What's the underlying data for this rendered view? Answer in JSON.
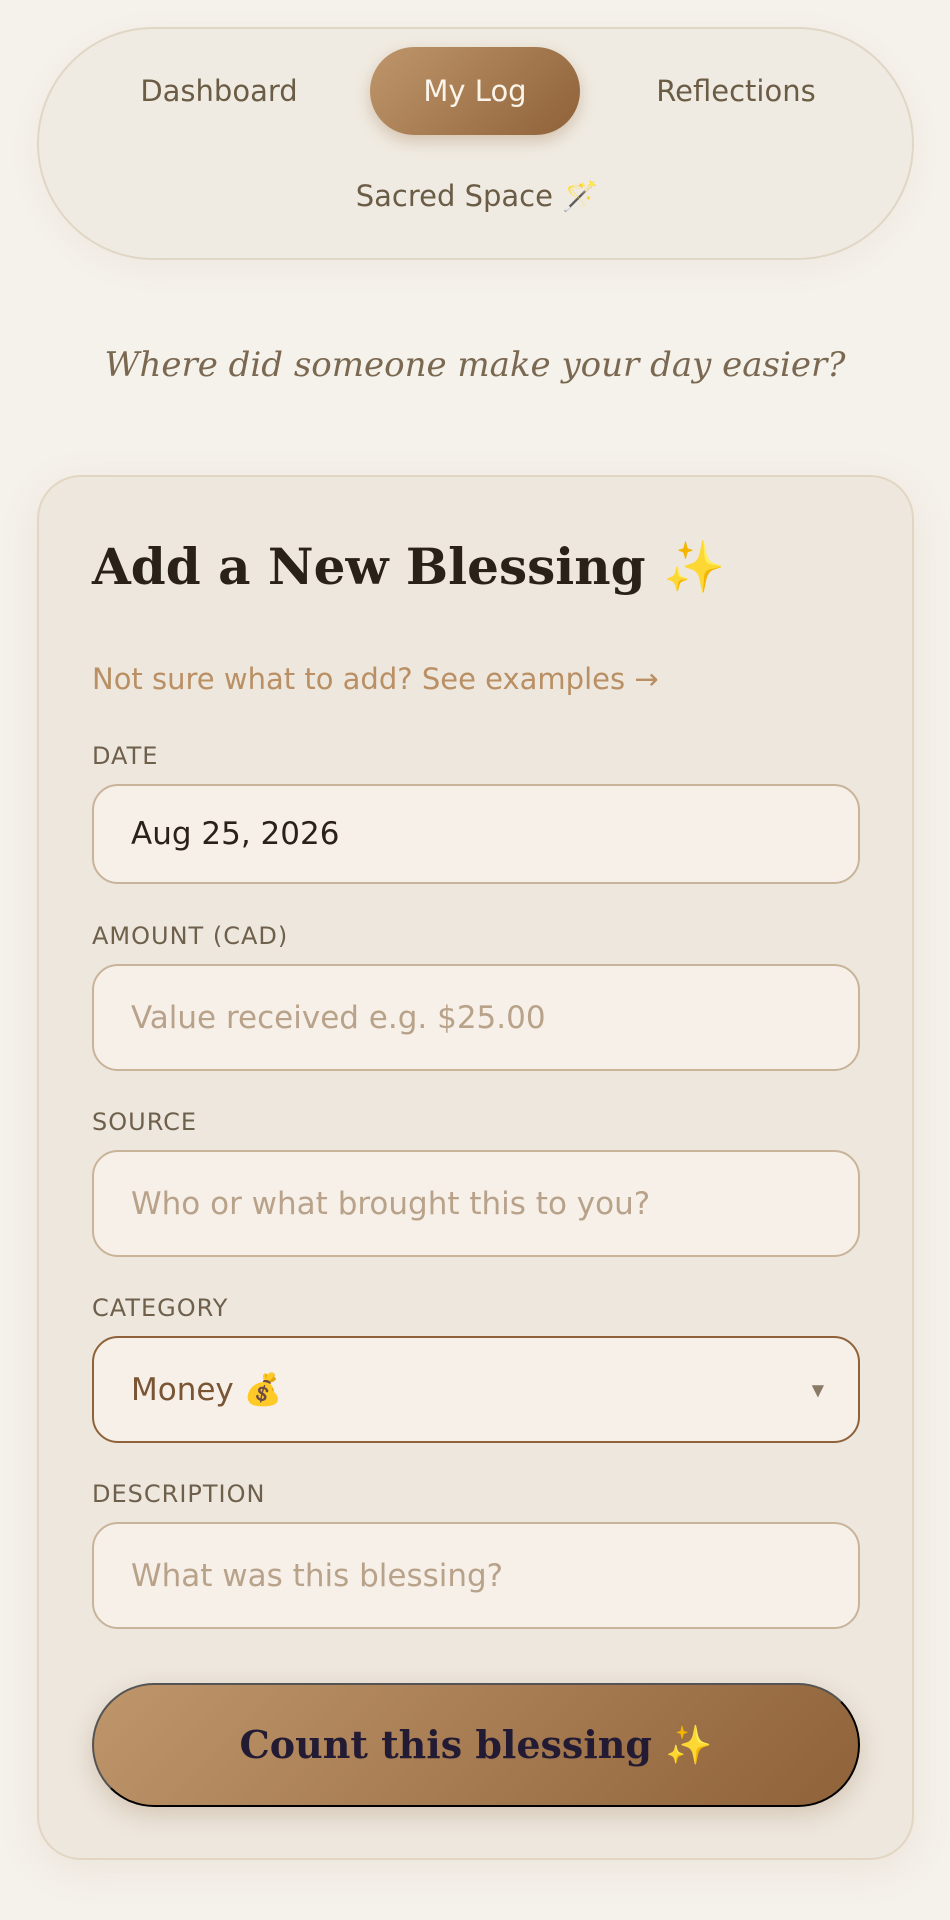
{
  "nav": {
    "tabs": [
      {
        "label": "Dashboard",
        "active": false
      },
      {
        "label": "My Log",
        "active": true
      },
      {
        "label": "Reflections",
        "active": false
      },
      {
        "label": "Sacred Space 🪄",
        "active": false
      }
    ]
  },
  "prompt": "Where did someone make your day easier?",
  "form": {
    "title": "Add a New Blessing ✨",
    "examples_link": "Not sure what to add? See examples →",
    "date": {
      "label": "DATE",
      "value": "Aug 25, 2026"
    },
    "amount": {
      "label": "AMOUNT (CAD)",
      "placeholder": "Value received e.g. $25.00"
    },
    "source": {
      "label": "SOURCE",
      "placeholder": "Who or what brought this to you?"
    },
    "category": {
      "label": "CATEGORY",
      "value": "Money 💰"
    },
    "description": {
      "label": "DESCRIPTION",
      "placeholder": "What was this blessing?"
    },
    "submit_label": "Count this blessing ✨"
  },
  "icons": {
    "select_chevron": "chevron-down-icon"
  },
  "colors": {
    "accent_start": "#bf966b",
    "accent_end": "#8f6239",
    "background": "#f5f1eb"
  }
}
